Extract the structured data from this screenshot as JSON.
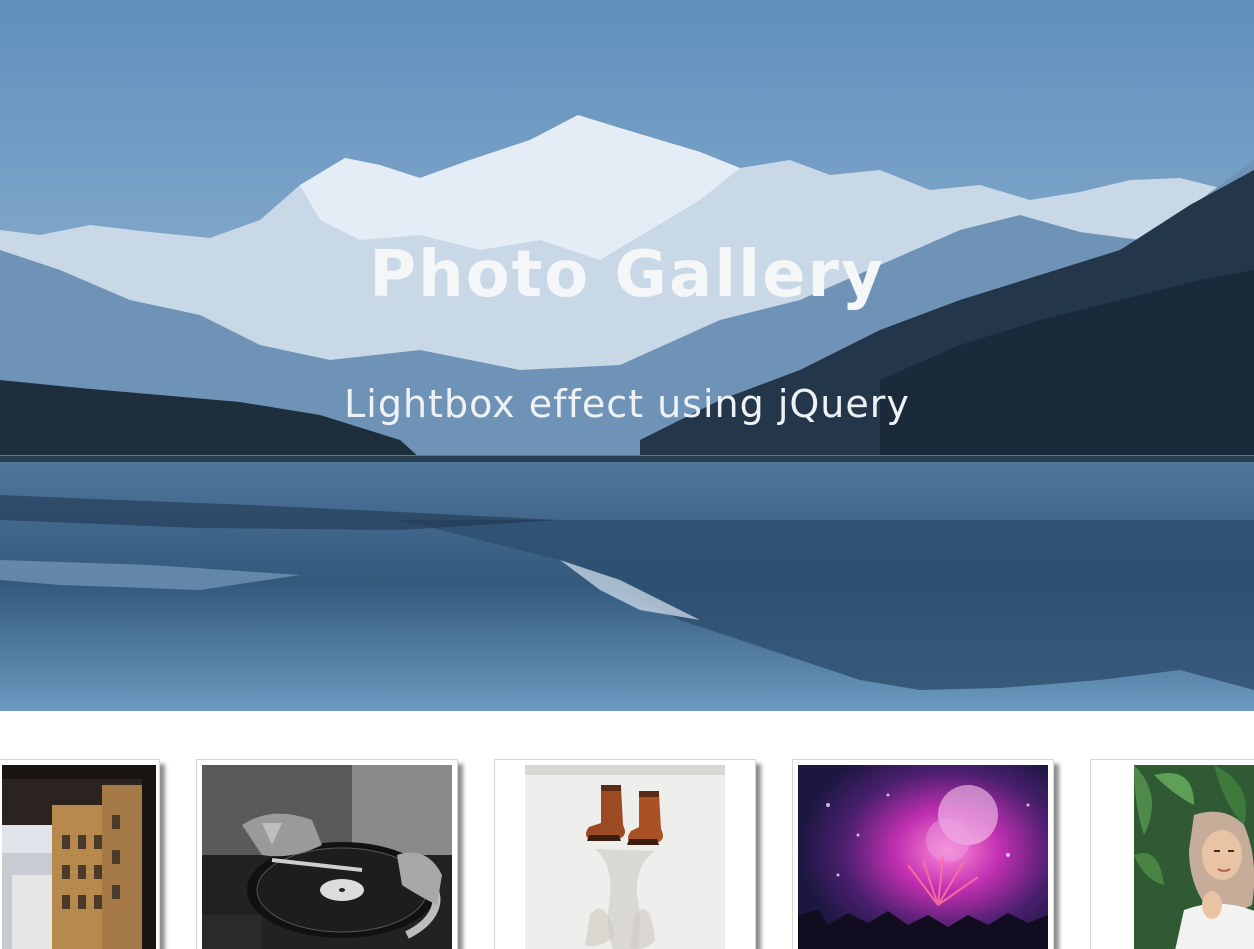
{
  "hero": {
    "title": "Photo Gallery",
    "subtitle": "Lightbox effect using jQuery",
    "background": "mountain-lake-image"
  },
  "gallery": {
    "items": [
      {
        "subject": "city-street-through-window-photo"
      },
      {
        "subject": "dj-turntable-photo"
      },
      {
        "subject": "boots-on-snow-photo"
      },
      {
        "subject": "concert-fireworks-photo"
      },
      {
        "subject": "woman-in-hijab-photo"
      }
    ]
  },
  "colors": {
    "sky": "#86aacb",
    "mountain": "#c9d8e6",
    "water": "#4b7aa2",
    "accent_purple": "#c02fb0"
  }
}
